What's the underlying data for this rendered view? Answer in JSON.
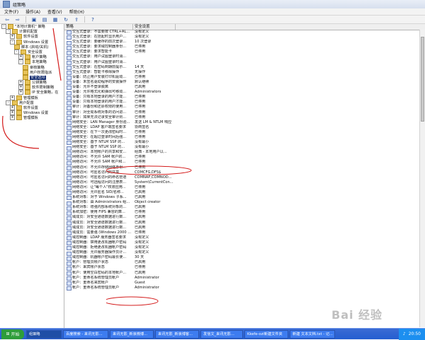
{
  "window": {
    "title": "组策略"
  },
  "menu": [
    "文件(F)",
    "操作(A)",
    "查看(V)",
    "帮助(H)"
  ],
  "toolbar": {
    "icons": [
      "back-arrow",
      "forward-arrow",
      "up-folder",
      "tree-toggle",
      "properties",
      "refresh",
      "export-list",
      "help"
    ]
  },
  "tree": {
    "items": [
      {
        "label": "\"本地计算机\" 策略",
        "indent": 0,
        "expander": "-",
        "selected": false
      },
      {
        "label": "计算机配置",
        "indent": 1,
        "expander": "-",
        "selected": false
      },
      {
        "label": "软件设置",
        "indent": 2,
        "expander": "+",
        "selected": false
      },
      {
        "label": "Windows 设置",
        "indent": 2,
        "expander": "-",
        "selected": false
      },
      {
        "label": "脚本 (启动/关机)",
        "indent": 3,
        "expander": "",
        "selected": false
      },
      {
        "label": "安全设置",
        "indent": 3,
        "expander": "-",
        "selected": false
      },
      {
        "label": "帐户策略",
        "indent": 4,
        "expander": "+",
        "selected": false
      },
      {
        "label": "本地策略",
        "indent": 4,
        "expander": "-",
        "selected": false
      },
      {
        "label": "审核策略",
        "indent": 5,
        "expander": "",
        "selected": false
      },
      {
        "label": "用户权限指派",
        "indent": 5,
        "expander": "",
        "selected": false
      },
      {
        "label": "安全选项",
        "indent": 5,
        "expander": "",
        "selected": true
      },
      {
        "label": "公钥策略",
        "indent": 4,
        "expander": "+",
        "selected": false
      },
      {
        "label": "软件限制策略",
        "indent": 4,
        "expander": "+",
        "selected": false
      },
      {
        "label": "IP 安全策略，在",
        "indent": 4,
        "expander": "+",
        "selected": false
      },
      {
        "label": "管理模板",
        "indent": 2,
        "expander": "+",
        "selected": false
      },
      {
        "label": "用户配置",
        "indent": 1,
        "expander": "-",
        "selected": false
      },
      {
        "label": "软件设置",
        "indent": 2,
        "expander": "+",
        "selected": false
      },
      {
        "label": "Windows 设置",
        "indent": 2,
        "expander": "+",
        "selected": false
      },
      {
        "label": "管理模板",
        "indent": 2,
        "expander": "+",
        "selected": false
      }
    ]
  },
  "columns": [
    "策略",
    "安全设置"
  ],
  "policies": [
    {
      "name": "交互式登录：不需要按 CTRL+AL...",
      "value": "没有定义"
    },
    {
      "name": "交互式登录：在挂起时显示用户...",
      "value": "没有定义"
    },
    {
      "name": "交互式登录：要缓存的前次登录...",
      "value": "10 次登录"
    },
    {
      "name": "交互式登录：要求域控制器身份...",
      "value": "已停用"
    },
    {
      "name": "交互式登录：要求智能卡",
      "value": "已停用"
    },
    {
      "name": "交互式登录：用户试图登录时消...",
      "value": ""
    },
    {
      "name": "交互式登录：用户试图登录时消...",
      "value": ""
    },
    {
      "name": "交互式登录：在密码到期前提示...",
      "value": "14 天"
    },
    {
      "name": "交互式登录：智能卡移除操作",
      "value": "无操作"
    },
    {
      "name": "设备：防止用户安装打印机驱动...",
      "value": "已停用"
    },
    {
      "name": "设备：未签名驱动程序的安装操作",
      "value": "默认继续"
    },
    {
      "name": "设备：允许不登录脱离",
      "value": "已启用"
    },
    {
      "name": "设备：允许格式化和弹出可移动...",
      "value": "Administrators"
    },
    {
      "name": "设备：只有本地登录的用户才能...",
      "value": "已停用"
    },
    {
      "name": "设备：只有本地登录的用户才能...",
      "value": "已停用"
    },
    {
      "name": "审计：对备份和还原权限的使用...",
      "value": "已停用"
    },
    {
      "name": "审计：对全局系统对象的访问进...",
      "value": "已停用"
    },
    {
      "name": "审计：如果无法记录安全审计则...",
      "value": "已停用"
    },
    {
      "name": "网络安全：LAN Manager 身份验...",
      "value": "发送 LM & NTLM 响应"
    },
    {
      "name": "网络安全：LDAP 客户端签名要求",
      "value": "协商签名"
    },
    {
      "name": "网络安全：在下一次更改密码时...",
      "value": "已停用"
    },
    {
      "name": "网络安全：在超过登录时间后强...",
      "value": "已停用"
    },
    {
      "name": "网络安全：基于 NTLM SSP 的...",
      "value": "没有最小"
    },
    {
      "name": "网络安全：基于 NTLM SSP 的...",
      "value": "没有最小"
    },
    {
      "name": "网络访问：本地帐户的共享和安...",
      "value": "经典 - 本地用户以..."
    },
    {
      "name": "网络访问：不允许 SAM 帐户的...",
      "value": "已停用"
    },
    {
      "name": "网络访问：不允许 SAM 帐户和...",
      "value": "已停用"
    },
    {
      "name": "网络访问：不允许存储网络身份...",
      "value": "已停用"
    },
    {
      "name": "网络访问：可匿名访问的共享",
      "value": "COMCFG,DFS$"
    },
    {
      "name": "网络访问：可匿名访问的命名管道",
      "value": "COMNAP,COMNOD..."
    },
    {
      "name": "网络访问：可远程访问的注册表...",
      "value": "System\\CurrentCon..."
    },
    {
      "name": "网络访问：让\"每个人\"权限应用...",
      "value": "已停用"
    },
    {
      "name": "网络访问：允许匿名 SID/名称...",
      "value": "已启用"
    },
    {
      "name": "系统对象：对于 Windows 子系...",
      "value": "已启用"
    },
    {
      "name": "系统对象：由 Administrators 组...",
      "value": "Object creator"
    },
    {
      "name": "系统对象：增强内部系统对象的...",
      "value": "已启用"
    },
    {
      "name": "系统加密：使用 FIPS 兼容的算...",
      "value": "已停用"
    },
    {
      "name": "域成员：对安全通道数据进行数...",
      "value": "已启用"
    },
    {
      "name": "域成员：对安全通道数据进行数...",
      "value": "已启用"
    },
    {
      "name": "域成员：对安全通道数据进行数...",
      "value": "已启用"
    },
    {
      "name": "域成员：需要强 (Windows 2000 ...",
      "value": "已停用"
    },
    {
      "name": "域控制器：LDAP 服务器签名要求",
      "value": "没有定义"
    },
    {
      "name": "域控制器：禁用更改机器帐户密码",
      "value": "没有定义"
    },
    {
      "name": "域控制器：拒绝更改机器帐户密码",
      "value": "没有定义"
    },
    {
      "name": "域控制器：允许服务器操作员计...",
      "value": "没有定义"
    },
    {
      "name": "域控制器：机器帐户密码最长使...",
      "value": "30 天"
    },
    {
      "name": "帐户：管理员帐户状态",
      "value": "已启用"
    },
    {
      "name": "帐户：来宾帐户状态",
      "value": "已停用"
    },
    {
      "name": "帐户：使用空白密码的本地帐户...",
      "value": "已启用"
    },
    {
      "name": "帐户：重命名系统管理员帐户",
      "value": "Administrator"
    },
    {
      "name": "帐户：重命名来宾帐户",
      "value": "Guest"
    },
    {
      "name": "帐户：重命名系统管理员帐户",
      "value": "Administrator"
    }
  ],
  "taskbar": {
    "start_label": "开始",
    "tasks": [
      {
        "label": "组策略",
        "active": true
      },
      {
        "label": "百度搜索 - 来讯无影...",
        "active": false
      },
      {
        "label": "来讯无影_新浪微博...",
        "active": false
      },
      {
        "label": "来讯无影_新浪博客...",
        "active": false
      },
      {
        "label": "发信文_来讯无影...",
        "active": false
      },
      {
        "label": "Kkefe-ozi新建文件夹",
        "active": false
      },
      {
        "label": "新建 文本文档.txt - 记...",
        "active": false
      }
    ],
    "clock": "20:50"
  },
  "watermark": "Bai 经验"
}
